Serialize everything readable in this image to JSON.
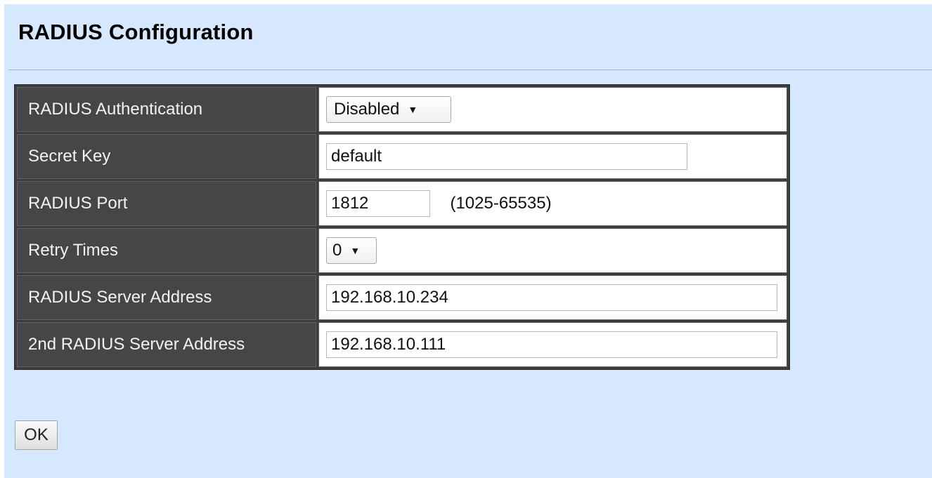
{
  "page": {
    "title": "RADIUS Configuration"
  },
  "form": {
    "radius_authentication": {
      "label": "RADIUS Authentication",
      "selected": "Disabled"
    },
    "secret_key": {
      "label": "Secret Key",
      "value": "default"
    },
    "radius_port": {
      "label": "RADIUS Port",
      "value": "1812",
      "range_hint": "(1025-65535)"
    },
    "retry_times": {
      "label": "Retry Times",
      "selected": "0"
    },
    "radius_server_address": {
      "label": "RADIUS Server Address",
      "value": "192.168.10.234"
    },
    "second_radius_server_address": {
      "label": "2nd RADIUS Server Address",
      "value": "192.168.10.111"
    }
  },
  "actions": {
    "ok_label": "OK"
  }
}
